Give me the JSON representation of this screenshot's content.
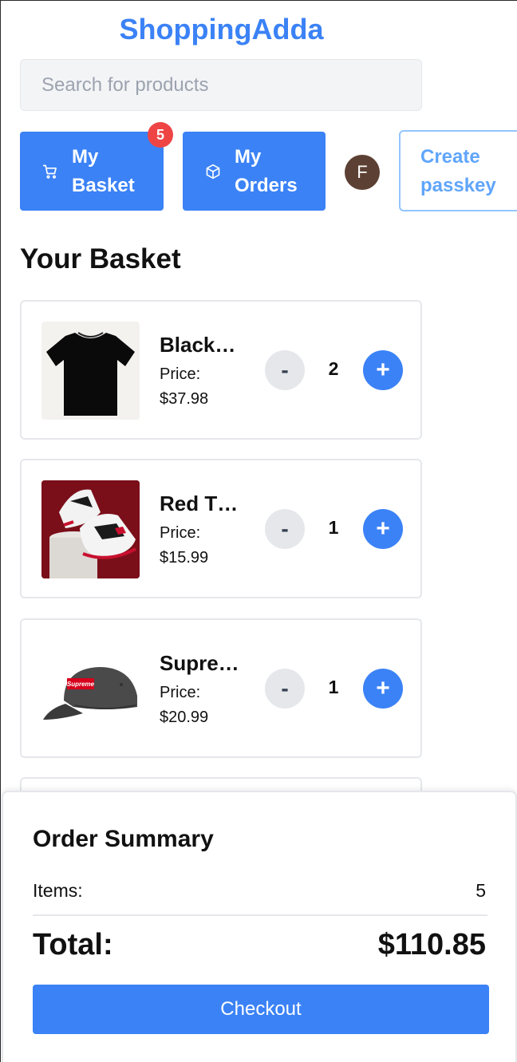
{
  "header": {
    "brand": "ShoppingAdda",
    "search_placeholder": "Search for products"
  },
  "nav": {
    "basket": {
      "label_line1": "My",
      "label_line2": "Basket",
      "icon": "cart-icon",
      "badge": "5"
    },
    "orders": {
      "label_line1": "My",
      "label_line2": "Orders",
      "icon": "box-icon"
    },
    "avatar_initial": "F",
    "passkey": {
      "label_line1": "Create",
      "label_line2": "passkey"
    }
  },
  "basket": {
    "title": "Your Basket",
    "items": [
      {
        "name": "Black…",
        "price_label": "Price:",
        "price": "$37.98",
        "qty": "2",
        "minus": "-",
        "plus": "+",
        "image": "black-tshirt"
      },
      {
        "name": "Red T…",
        "price_label": "Price:",
        "price": "$15.99",
        "qty": "1",
        "minus": "-",
        "plus": "+",
        "image": "red-sneakers"
      },
      {
        "name": "Supre…",
        "price_label": "Price:",
        "price": "$20.99",
        "qty": "1",
        "minus": "-",
        "plus": "+",
        "image": "supreme-cap",
        "logo_text": "Supreme"
      }
    ]
  },
  "summary": {
    "title": "Order Summary",
    "items_label": "Items:",
    "items_value": "5",
    "total_label": "Total:",
    "total_value": "$110.85",
    "checkout_label": "Checkout"
  },
  "colors": {
    "primary": "#3b82f6",
    "badge": "#ef4444",
    "avatar": "#5c4033",
    "passkey_border": "#93c5fd"
  }
}
